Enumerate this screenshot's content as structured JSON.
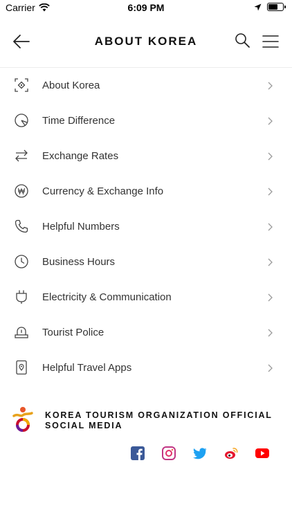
{
  "status_bar": {
    "carrier": "Carrier",
    "time": "6:09 PM",
    "battery_level": 0.7
  },
  "header": {
    "title": "ABOUT KOREA"
  },
  "menu": {
    "items": [
      {
        "label": "About Korea",
        "icon": "focus-frame-icon"
      },
      {
        "label": "Time Difference",
        "icon": "clock-pie-icon"
      },
      {
        "label": "Exchange Rates",
        "icon": "swap-arrows-icon"
      },
      {
        "label": "Currency & Exchange Info",
        "icon": "won-coin-icon"
      },
      {
        "label": "Helpful Numbers",
        "icon": "phone-icon"
      },
      {
        "label": "Business Hours",
        "icon": "clock-icon"
      },
      {
        "label": "Electricity & Communication",
        "icon": "plug-icon"
      },
      {
        "label": "Tourist Police",
        "icon": "police-siren-icon"
      },
      {
        "label": "Helpful Travel Apps",
        "icon": "phone-location-icon"
      }
    ]
  },
  "footer": {
    "title": "KOREA TOURISM ORGANIZATION OFFICIAL SOCIAL MEDIA",
    "social": [
      "facebook-icon",
      "instagram-icon",
      "twitter-icon",
      "weibo-icon",
      "youtube-icon"
    ]
  },
  "colors": {
    "icon_gray": "#444444",
    "chevron": "#9a9a9a",
    "facebook": "#3b5998",
    "instagram": "#c13584",
    "twitter": "#1da1f2",
    "weibo": "#e6162d",
    "youtube": "#ff0000"
  }
}
